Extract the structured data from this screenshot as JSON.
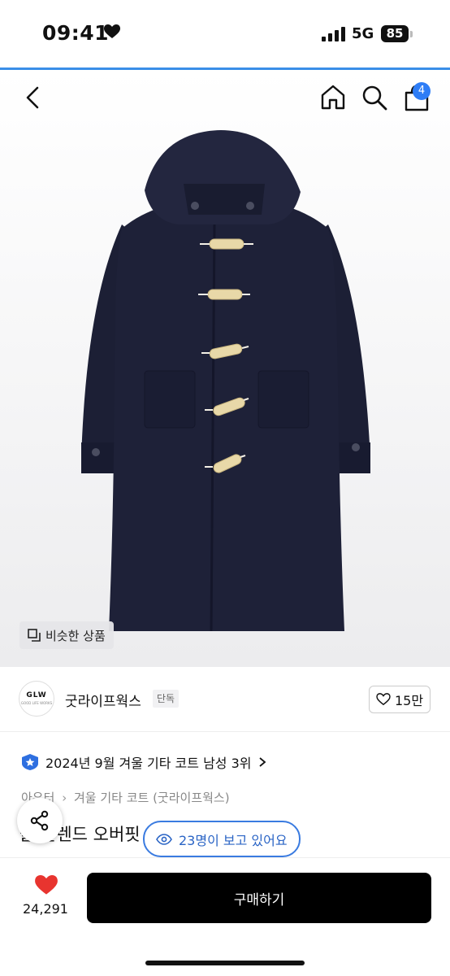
{
  "status_bar": {
    "time": "09:41",
    "network": "5G",
    "battery": "85"
  },
  "header": {
    "cart_count": "4"
  },
  "hero": {
    "similar_label": "비슷한 상품"
  },
  "brand": {
    "logo_text": "GLW",
    "logo_sub": "GOOD LIFE WORKS",
    "name": "굿라이프웍스",
    "tag": "단독",
    "likes": "15만"
  },
  "ranking": {
    "text": "2024년 9월 겨울 기타 코트 남성 3위"
  },
  "breadcrumb": {
    "category": "아우터",
    "sub_category": "겨울 기타 코트 (굿라이프웍스)"
  },
  "product": {
    "title": "울 블렌드 오버핏"
  },
  "viewers": {
    "text": "23명이 보고 있어요"
  },
  "bottom_bar": {
    "wish_count": "24,291",
    "buy_label": "구매하기"
  },
  "colors": {
    "accent": "#3a7be0",
    "badge": "#2e7df6",
    "heart": "#e8342f",
    "coat": "#1e2138"
  }
}
